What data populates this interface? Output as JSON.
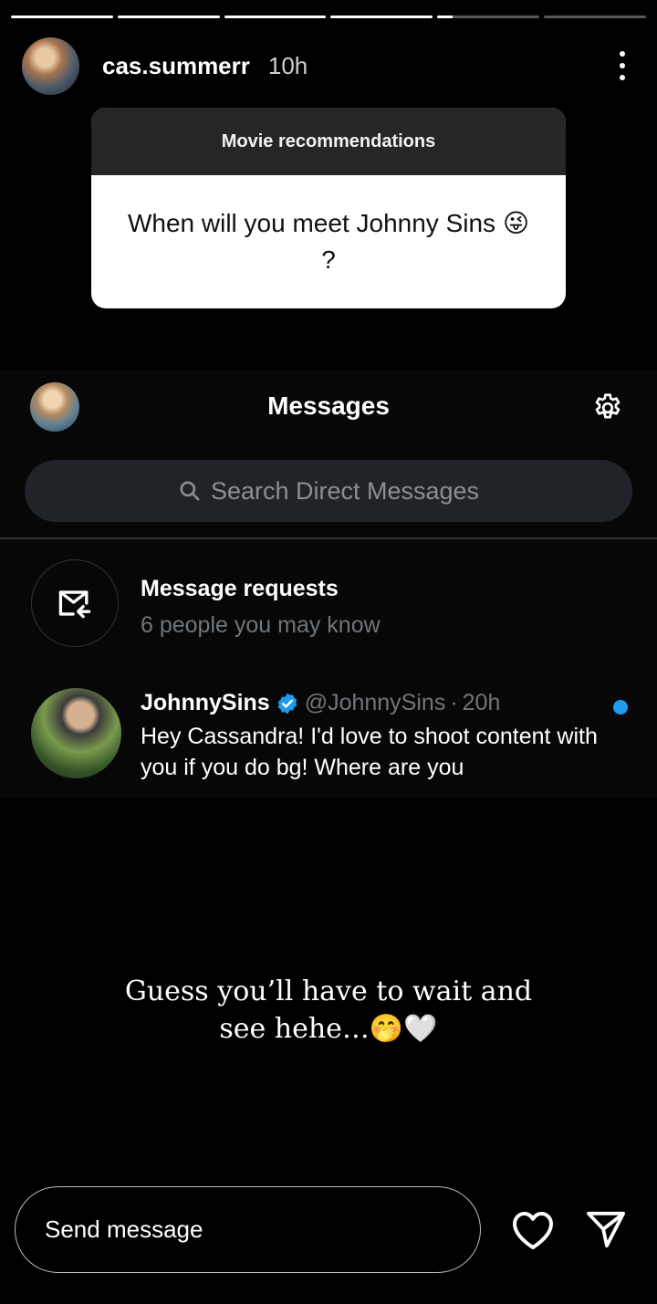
{
  "story": {
    "progress": [
      1,
      1,
      1,
      1,
      0.15,
      0
    ],
    "username": "cas.summerr",
    "time": "10h",
    "question_box": {
      "header": "Movie recommendations",
      "question": "When will you meet Johnny Sins 😜 ?"
    },
    "overlay_text": "Guess you’ll have to wait and see hehe…🤭🤍",
    "send_placeholder": "Send message"
  },
  "twitter": {
    "title": "Messages",
    "search_placeholder": "Search Direct Messages",
    "message_requests": {
      "title": "Message requests",
      "subtitle": "6 people you may know"
    },
    "dm": {
      "name": "JohnnySins",
      "handle": "@JohnnySins",
      "separator": "·",
      "time": "20h",
      "message": "Hey Cassandra! I'd love to shoot content with you if you do bg! Where are you"
    }
  },
  "colors": {
    "accent": "#1d9bf0",
    "muted": "#71767b",
    "search_bg": "#202327"
  },
  "icons": [
    "more-vertical-icon",
    "gear-icon",
    "search-icon",
    "mail-arrow-icon",
    "verified-badge-icon",
    "heart-icon",
    "send-icon"
  ]
}
